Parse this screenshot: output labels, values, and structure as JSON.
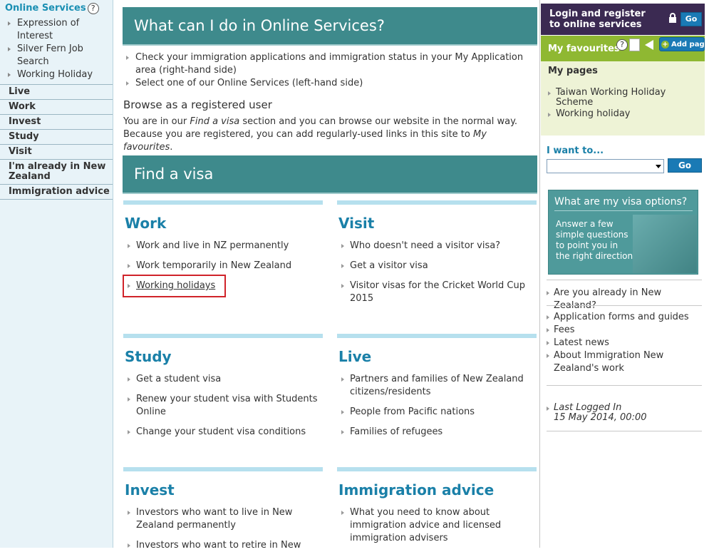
{
  "left_nav": {
    "title": "Online Services",
    "help": "?",
    "sub_items": [
      "Expression of Interest",
      "Silver Fern Job Search",
      "Working Holiday"
    ],
    "categories": [
      "Live",
      "Work",
      "Invest",
      "Study",
      "Visit",
      "I'm already in New Zealand",
      "Immigration advice"
    ]
  },
  "main": {
    "banner1": "What can I do in Online Services?",
    "intro_items": [
      "Check your immigration applications and immigration status in your My Application area (right-hand side)",
      "Select one of our Online Services (left-hand side)"
    ],
    "browse_heading": "Browse as a registered user",
    "browse_text_line1_a": "You are in our ",
    "browse_text_line1_em": "Find a visa",
    "browse_text_line1_b": " section and you can browse our website in the normal way.",
    "browse_text_line2_a": "Because you are registered, you can add regularly-used links in this site to ",
    "browse_text_line2_em": "My favourites",
    "browse_text_line2_b": ".",
    "banner2": "Find a visa",
    "sections": {
      "work": {
        "title": "Work",
        "items": [
          "Work and live in NZ permanently",
          "Work temporarily in New Zealand",
          "Working holidays"
        ]
      },
      "visit": {
        "title": "Visit",
        "items": [
          "Who doesn't need a visitor visa?",
          "Get a visitor visa",
          "Visitor visas for the Cricket World Cup 2015"
        ]
      },
      "study": {
        "title": "Study",
        "items": [
          "Get a student visa",
          "Renew your student visa with Students Online",
          "Change your student visa conditions"
        ]
      },
      "live": {
        "title": "Live",
        "items": [
          "Partners and families of New Zealand citizens/residents",
          "People from Pacific nations",
          "Families of refugees"
        ]
      },
      "invest": {
        "title": "Invest",
        "items": [
          "Investors who want to live in New Zealand permanently",
          "Investors who want to retire in New"
        ]
      },
      "advice": {
        "title": "Immigration advice",
        "items": [
          "What you need to know about immigration advice and licensed immigration advisers"
        ]
      }
    }
  },
  "right": {
    "login_text": "Login and register to online services",
    "go": "Go",
    "favourites_label": "My favourites",
    "help": "?",
    "add_page": "Add page",
    "add_plus": "+",
    "my_pages_heading": "My pages",
    "my_pages": [
      "Taiwan Working Holiday Scheme",
      "Working holiday"
    ],
    "i_want_to": "I want to...",
    "select_value": "",
    "go2": "Go",
    "promo_title": "What are my visa options?",
    "promo_body": "Answer a few simple questions to point you in the right direction",
    "list1": [
      "Are you already in New Zealand?"
    ],
    "list2": [
      "Application forms and guides",
      "Fees",
      "Latest news",
      "About Immigration New Zealand's work"
    ],
    "last_logged_label": "Last Logged In",
    "last_logged_value": "15 May 2014, 00:00"
  },
  "colors": {
    "banner": "#3e8a8c",
    "link_heading": "#1a80a8",
    "highlight": "#d0232a",
    "favbar": "#8fb832",
    "login": "#3b2a52"
  }
}
